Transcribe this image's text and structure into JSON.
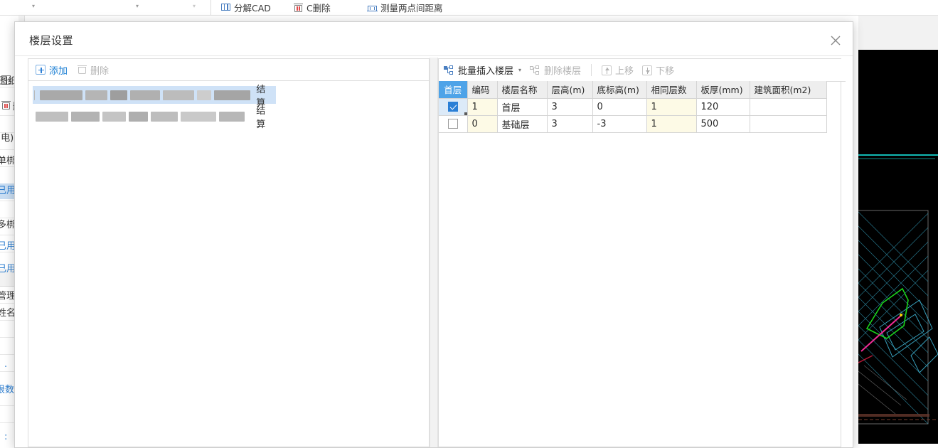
{
  "ribbon": {
    "carets": [
      "caret-1",
      "caret-2",
      "caret-3"
    ],
    "buttons": [
      {
        "label": "分解CAD",
        "icon": "explode-cad-icon"
      },
      {
        "label": "C删除",
        "icon": "delete-icon"
      },
      {
        "label": "测量两点间距离",
        "icon": "measure-distance-icon"
      }
    ]
  },
  "sidebar": {
    "items": [
      {
        "label": "图纸",
        "color": "#3a3a3a"
      },
      {
        "label": "删",
        "color": "#3a3a3a"
      },
      {
        "label": "(电)",
        "color": "#3a3a3a"
      },
      {
        "label": "单梆",
        "color": "#3a3a3a"
      },
      {
        "label": "已用",
        "color": "#2f7fd0"
      },
      {
        "label": "多梆",
        "color": "#3a3a3a"
      },
      {
        "label": "已用",
        "color": "#2f7fd0"
      },
      {
        "label": "已用",
        "color": "#2f7fd0"
      },
      {
        "label": "管理",
        "color": "#3a3a3a"
      },
      {
        "label": "姓名",
        "color": "#3a3a3a"
      },
      {
        "label": "·",
        "color": "#2f7fd0"
      },
      {
        "label": "根数",
        "color": "#2f7fd0"
      },
      {
        "label": ":",
        "color": "#2f7fd0"
      }
    ]
  },
  "dialog": {
    "title": "楼层设置",
    "close_label": "×",
    "left_pane": {
      "toolbar": [
        {
          "label": "添加",
          "icon": "plus-icon",
          "enabled": true
        },
        {
          "label": "删除",
          "icon": "trash-icon",
          "enabled": false
        }
      ],
      "items": [
        {
          "tail": "结算",
          "selected": true
        },
        {
          "tail": "结算",
          "selected": false
        }
      ]
    },
    "right_pane": {
      "toolbar": [
        {
          "label": "批量插入楼层",
          "icon": "batch-insert-floor-icon",
          "enabled": true,
          "dropdown": true
        },
        {
          "label": "删除楼层",
          "icon": "delete-floor-icon",
          "enabled": false,
          "dropdown": false
        },
        {
          "label": "上移",
          "icon": "arrow-up-icon",
          "enabled": false,
          "dropdown": false
        },
        {
          "label": "下移",
          "icon": "arrow-down-icon",
          "enabled": false,
          "dropdown": false
        }
      ],
      "table": {
        "columns": [
          "首层",
          "编码",
          "楼层名称",
          "层高(m)",
          "底标高(m)",
          "相同层数",
          "板厚(mm)",
          "建筑面积(m2)"
        ],
        "rows": [
          {
            "checked": true,
            "code": "1",
            "name": "首层",
            "height": "3",
            "base": "0",
            "same": "1",
            "slab": "120",
            "area": ""
          },
          {
            "checked": false,
            "code": "0",
            "name": "基础层",
            "height": "3",
            "base": "-3",
            "same": "1",
            "slab": "500",
            "area": ""
          }
        ]
      }
    }
  },
  "colors": {
    "accent": "#4ea3e8",
    "link": "#2f7fd0",
    "header_bg": "#eeeeee",
    "yellow_cell": "#fdfae6",
    "cad_bg": "#000000"
  }
}
